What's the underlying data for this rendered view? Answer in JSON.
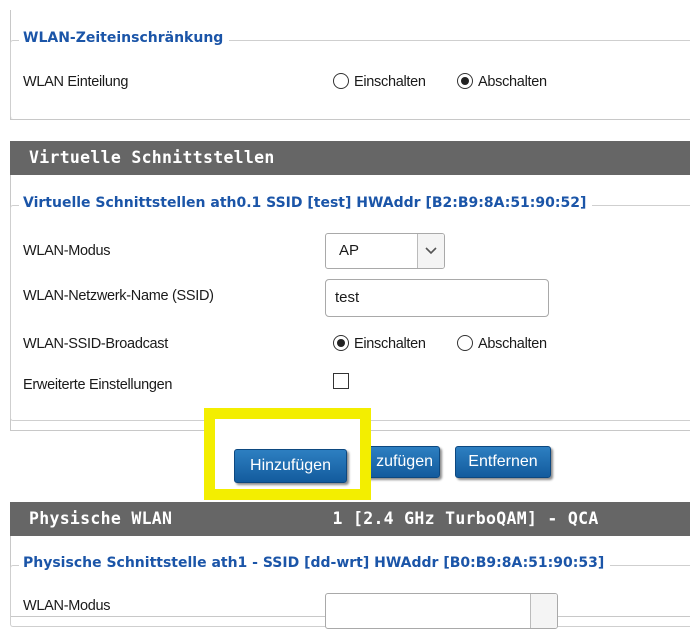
{
  "wlan_time": {
    "legend": "WLAN-Zeiteinschränkung",
    "schedule_label": "WLAN Einteilung",
    "opt_on": "Einschalten",
    "opt_off": "Abschalten"
  },
  "virtual": {
    "header": "Virtuelle Schnittstellen",
    "legend": "Virtuelle Schnittstellen ath0.1 SSID [test] HWAddr [B2:B9:8A:51:90:52]",
    "mode_label": "WLAN-Modus",
    "mode_value": "AP",
    "ssid_label": "WLAN-Netzwerk-Name (SSID)",
    "ssid_value": "test",
    "broadcast_label": "WLAN-SSID-Broadcast",
    "broadcast_on": "Einschalten",
    "broadcast_off": "Abschalten",
    "advanced_label": "Erweiterte Einstellungen"
  },
  "buttons": {
    "add": "Hinzufügen",
    "add_behind_fragment": "zufügen",
    "remove": "Entfernen"
  },
  "physical": {
    "header_left": "Physische WLAN ",
    "header_right": "1 [2.4 GHz TurboQAM] - QCA",
    "legend": "Physische Schnittstelle ath1 - SSID [dd-wrt] HWAddr [B0:B9:8A:51:90:53]",
    "mode_label_partial": "WLAN-Modus"
  },
  "colors": {
    "legend": "#1b55a8",
    "header_bg": "#666666",
    "button": "#1f6db0",
    "highlight": "#f3ee00"
  }
}
